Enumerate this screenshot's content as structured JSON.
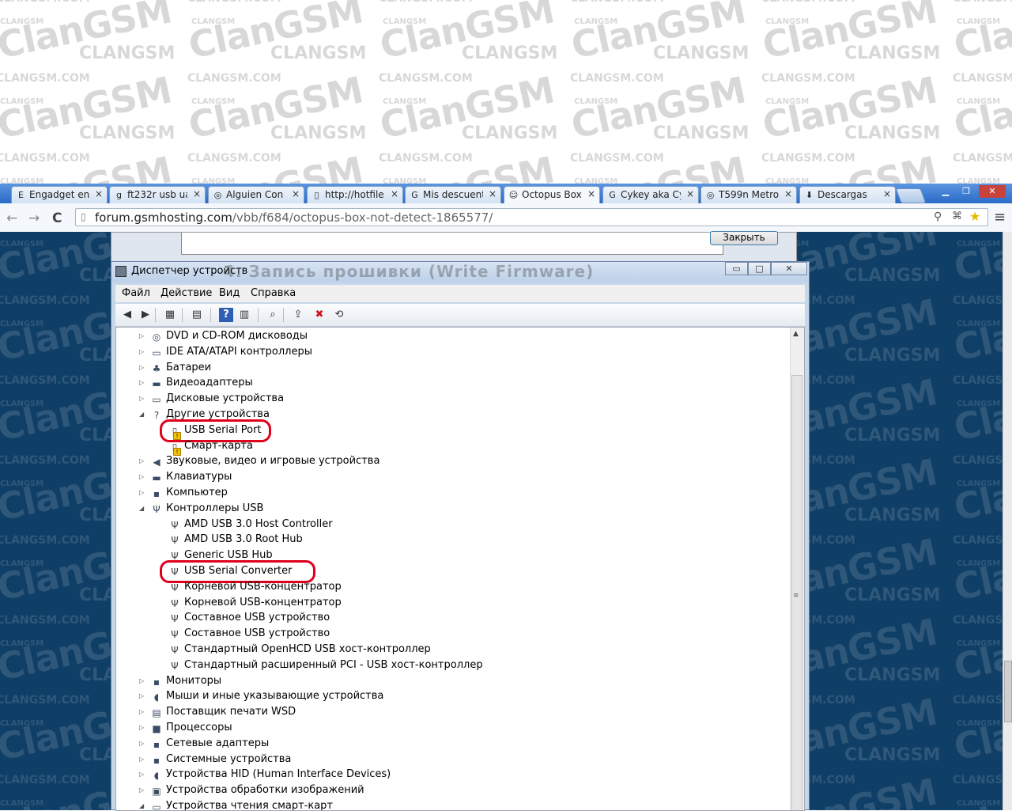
{
  "watermark": {
    "brand": "ClanGSM",
    "upper": "CLANGSM",
    "site": "CLANGSM.COM"
  },
  "browser": {
    "tabs": [
      {
        "label": "Engadget en",
        "icon": "E",
        "active": false
      },
      {
        "label": "ft232r usb ua",
        "icon": "g",
        "active": false
      },
      {
        "label": "Alguien Con",
        "icon": "◎",
        "active": false
      },
      {
        "label": "http://hotfile",
        "icon": "▯",
        "active": false
      },
      {
        "label": "Mis descuent",
        "icon": "G",
        "active": false
      },
      {
        "label": "Octopus Box",
        "icon": "☺",
        "active": true
      },
      {
        "label": "Cykey aka Cy",
        "icon": "G",
        "active": false
      },
      {
        "label": "T599n Metro",
        "icon": "◎",
        "active": false
      },
      {
        "label": "Descargas",
        "icon": "⬇",
        "active": false
      }
    ],
    "tab_close_glyph": "×",
    "window_buttons": {
      "minimize": "▁",
      "maximize": "❐",
      "close": "✕"
    },
    "url_host": "forum.gsmhosting.com",
    "url_path": "/vbb/f684/octopus-box-not-detect-1865577/",
    "nav": {
      "back": "←",
      "forward": "→",
      "reload": "C"
    },
    "right_icons": {
      "zoom": "⚲",
      "translate": "⌘",
      "star": "★",
      "menu": "≡"
    }
  },
  "behind_dialog": {
    "close_label": "Закрыть",
    "overlay_text": "4. Запись прошивки (Write Firmware)"
  },
  "device_manager": {
    "title": "Диспетчер устройств",
    "caption_buttons": {
      "minimize": "▭",
      "maximize": "□",
      "close": "✕"
    },
    "menu": [
      "Файл",
      "Действие",
      "Вид",
      "Справка"
    ],
    "toolbar_icons": [
      "◀",
      "▶",
      "▦",
      "▤",
      "?",
      "▥",
      "⌕",
      "⇪",
      "✖",
      "⟲"
    ],
    "tree": [
      {
        "label": "DVD и CD-ROM дисководы",
        "icon": "◎",
        "level": 0,
        "expanded": false
      },
      {
        "label": "IDE ATA/ATAPI контроллеры",
        "icon": "▭",
        "level": 0,
        "expanded": false
      },
      {
        "label": "Батареи",
        "icon": "♣",
        "level": 0,
        "expanded": false
      },
      {
        "label": "Видеоадаптеры",
        "icon": "▬",
        "level": 0,
        "expanded": false
      },
      {
        "label": "Дисковые устройства",
        "icon": "▭",
        "level": 0,
        "expanded": false
      },
      {
        "label": "Другие устройства",
        "icon": "?",
        "level": 0,
        "expanded": true
      },
      {
        "label": "USB Serial Port",
        "icon": "!",
        "level": 1,
        "warning": true,
        "highlighted": true
      },
      {
        "label": "Смарт-карта",
        "icon": "!",
        "level": 1,
        "warning": true
      },
      {
        "label": "Звуковые, видео и игровые устройства",
        "icon": "◀",
        "level": 0,
        "expanded": false
      },
      {
        "label": "Клавиатуры",
        "icon": "▬",
        "level": 0,
        "expanded": false
      },
      {
        "label": "Компьютер",
        "icon": "▪",
        "level": 0,
        "expanded": false
      },
      {
        "label": "Контроллеры USB",
        "icon": "Ψ",
        "level": 0,
        "expanded": true
      },
      {
        "label": "AMD USB 3.0 Host Controller",
        "icon": "Ψ",
        "level": 1
      },
      {
        "label": "AMD USB 3.0 Root Hub",
        "icon": "Ψ",
        "level": 1
      },
      {
        "label": "Generic USB Hub",
        "icon": "Ψ",
        "level": 1
      },
      {
        "label": "USB Serial Converter",
        "icon": "Ψ",
        "level": 1,
        "highlighted": true
      },
      {
        "label": "Корневой USB-концентратор",
        "icon": "Ψ",
        "level": 1
      },
      {
        "label": "Корневой USB-концентратор",
        "icon": "Ψ",
        "level": 1
      },
      {
        "label": "Составное USB устройство",
        "icon": "Ψ",
        "level": 1
      },
      {
        "label": "Составное USB устройство",
        "icon": "Ψ",
        "level": 1
      },
      {
        "label": "Стандартный OpenHCD USB хост-контроллер",
        "icon": "Ψ",
        "level": 1
      },
      {
        "label": "Стандартный расширенный PCI - USB хост-контроллер",
        "icon": "Ψ",
        "level": 1
      },
      {
        "label": "Мониторы",
        "icon": "▪",
        "level": 0,
        "expanded": false
      },
      {
        "label": "Мыши и иные указывающие устройства",
        "icon": "◖",
        "level": 0,
        "expanded": false
      },
      {
        "label": "Поставщик печати WSD",
        "icon": "▤",
        "level": 0,
        "expanded": false
      },
      {
        "label": "Процессоры",
        "icon": "■",
        "level": 0,
        "expanded": false
      },
      {
        "label": "Сетевые адаптеры",
        "icon": "▪",
        "level": 0,
        "expanded": false
      },
      {
        "label": "Системные устройства",
        "icon": "▪",
        "level": 0,
        "expanded": false
      },
      {
        "label": "Устройства HID (Human Interface Devices)",
        "icon": "◖",
        "level": 0,
        "expanded": false
      },
      {
        "label": "Устройства обработки изображений",
        "icon": "▣",
        "level": 0,
        "expanded": false
      },
      {
        "label": "Устройства чтения смарт-карт",
        "icon": "▭",
        "level": 0,
        "expanded": true
      }
    ],
    "colors": {
      "highlight": "#e0001b",
      "warning": "#f3c300"
    }
  }
}
